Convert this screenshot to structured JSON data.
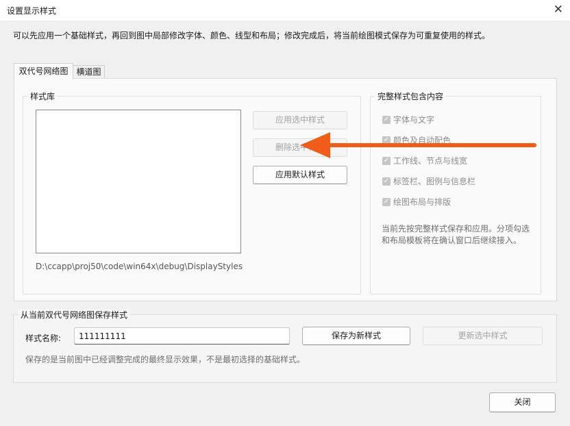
{
  "window": {
    "title": "设置显示样式",
    "close_glyph": "✕"
  },
  "instruction": "可以先应用一个基础样式，再回到图中局部修改字体、颜色、线型和布局；修改完成后，将当前绘图模式保存为可重复使用的样式。",
  "tabs": [
    {
      "label": "双代号网络图",
      "active": true
    },
    {
      "label": "横道图",
      "active": false
    }
  ],
  "library": {
    "group_title": "样式库",
    "path": "D:\\ccapp\\proj50\\code\\win64x\\debug\\DisplayStyles",
    "buttons": {
      "apply_selected": "应用选中样式",
      "delete_selected": "删除选中样式",
      "apply_default": "应用默认样式"
    }
  },
  "contents": {
    "group_title": "完整样式包含内容",
    "items": [
      {
        "label": "字体与文字",
        "checked": true
      },
      {
        "label": "颜色及自动配色",
        "checked": true
      },
      {
        "label": "工作线、节点与线宽",
        "checked": true
      },
      {
        "label": "标签栏、图例与信息栏",
        "checked": true
      },
      {
        "label": "绘图布局与排版",
        "checked": true
      }
    ],
    "note": "当前先按完整样式保存和应用。分项勾选和布局模板将在确认窗口后继续接入。"
  },
  "save": {
    "group_title": "从当前双代号网络图保存样式",
    "name_label": "样式名称:",
    "name_value": "111111111",
    "save_new_label": "保存为新样式",
    "update_selected_label": "更新选中样式",
    "hint": "保存的是当前图中已经调整完成的最终显示效果，不是最初选择的基础样式。"
  },
  "footer": {
    "close_label": "关闭"
  },
  "colors": {
    "annotation_arrow": "#f25c19",
    "disabled_text": "#a3a3a3"
  }
}
